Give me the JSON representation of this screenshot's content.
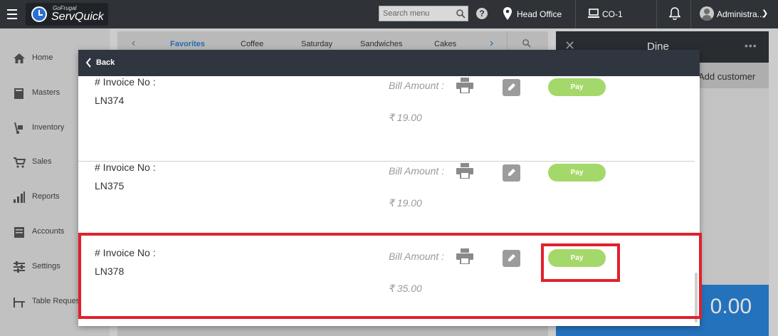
{
  "app": {
    "logo_sub": "GoFrugal",
    "logo_main": "ServQuick"
  },
  "header": {
    "search_placeholder": "Search menu",
    "location": "Head Office",
    "counter": "CO-1",
    "user": "Administra...",
    "help_symbol": "?"
  },
  "sidebar": {
    "items": [
      {
        "label": "Home",
        "icon": "home-icon"
      },
      {
        "label": "Masters",
        "icon": "book-icon"
      },
      {
        "label": "Inventory",
        "icon": "hand-truck-icon"
      },
      {
        "label": "Sales",
        "icon": "cart-icon"
      },
      {
        "label": "Reports",
        "icon": "bar-chart-icon"
      },
      {
        "label": "Accounts",
        "icon": "ledger-icon"
      },
      {
        "label": "Settings",
        "icon": "sliders-icon"
      },
      {
        "label": "Table Request",
        "icon": "table-icon"
      }
    ]
  },
  "categories": {
    "items": [
      "Favorites",
      "Coffee",
      "Saturday",
      "Sandwiches",
      "Cakes"
    ],
    "active": "Favorites"
  },
  "order_panel": {
    "title": "Dine",
    "add_customer": "Add customer",
    "total": "0.00"
  },
  "modal": {
    "back_label": "Back",
    "invoice_label": "# Invoice No :",
    "bill_label": "Bill Amount :",
    "pay_label": "Pay",
    "invoices": [
      {
        "number": "LN374",
        "amount": "₹ 19.00"
      },
      {
        "number": "LN375",
        "amount": "₹ 19.00"
      },
      {
        "number": "LN378",
        "amount": "₹ 35.00"
      }
    ]
  },
  "colors": {
    "topbar": "#2f3338",
    "pay_button": "#a5d86a",
    "highlight": "#e0212b",
    "accent_blue": "#2a82d6"
  }
}
